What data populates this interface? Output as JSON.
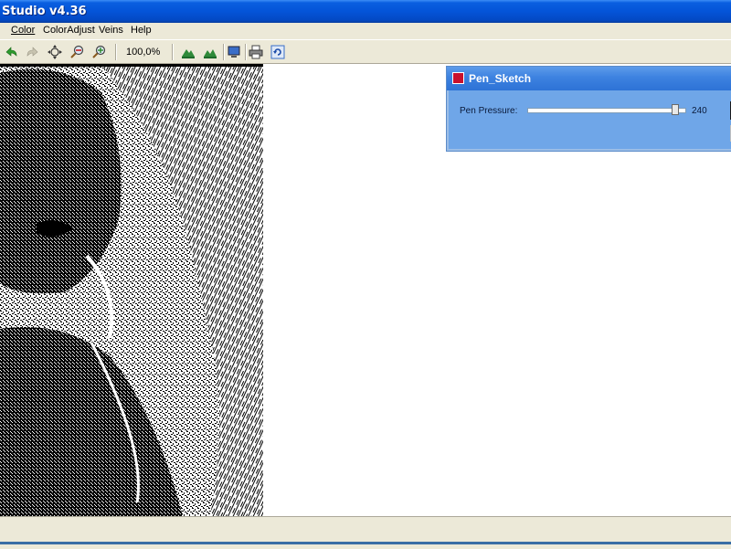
{
  "app": {
    "title": "Studio v4.36"
  },
  "menu": [
    {
      "label": "Color"
    },
    {
      "label": "ColorAdjust"
    },
    {
      "label": "Veins"
    },
    {
      "label": "Help"
    }
  ],
  "toolbar": {
    "icons": [
      "undo-icon",
      "redo-icon",
      "pan-icon",
      "zoom-out-icon",
      "zoom-in-icon",
      "mountain-icon",
      "mountain-icon",
      "monitor-icon",
      "print-icon",
      "refresh-icon"
    ],
    "zoom_value": "100,0%"
  },
  "dialog": {
    "title": "Pen_Sketch",
    "pen_pressure_label": "Pen Pressure:",
    "pen_pressure_value": "240",
    "slider_fraction": 0.94
  },
  "colors": {
    "titlebar": "#0454d8",
    "dialog_body": "#6fa6e8"
  }
}
